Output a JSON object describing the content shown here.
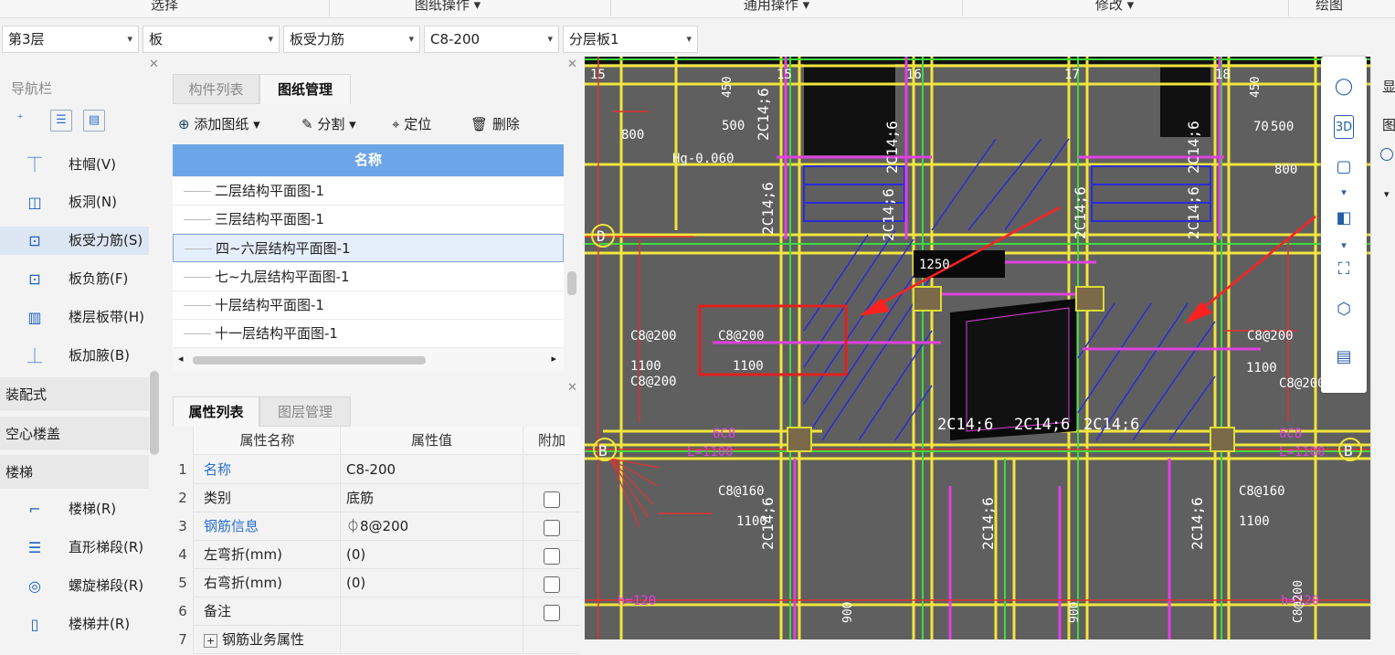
{
  "ribbon": {
    "groups": [
      "选择",
      "图纸操作 ▾",
      "通用操作 ▾",
      "修改 ▾",
      "绘图"
    ]
  },
  "toolbar": {
    "floor": "第3层",
    "type": "板",
    "subtype": "板受力筋",
    "spec": "C8-200",
    "layer": "分层板1"
  },
  "nav": {
    "title": "导航栏",
    "items": [
      {
        "label": "柱帽(V)",
        "icon": "column-cap-icon"
      },
      {
        "label": "板洞(N)",
        "icon": "slab-hole-icon"
      },
      {
        "label": "板受力筋(S)",
        "icon": "slab-rebar-icon"
      },
      {
        "label": "板负筋(F)",
        "icon": "slab-negative-rebar-icon"
      },
      {
        "label": "楼层板带(H)",
        "icon": "floor-strip-icon"
      },
      {
        "label": "板加腋(B)",
        "icon": "slab-haunch-icon"
      }
    ],
    "categories": [
      "装配式",
      "空心楼盖",
      "楼梯"
    ],
    "stair_items": [
      {
        "label": "楼梯(R)",
        "icon": "stair-icon"
      },
      {
        "label": "直形梯段(R)",
        "icon": "straight-flight-icon"
      },
      {
        "label": "螺旋梯段(R)",
        "icon": "spiral-flight-icon"
      },
      {
        "label": "楼梯井(R)",
        "icon": "stairwell-icon"
      }
    ]
  },
  "drawings": {
    "tabs": [
      "构件列表",
      "图纸管理"
    ],
    "buttons": [
      "添加图纸",
      "分割",
      "定位",
      "删除"
    ],
    "column_header": "名称",
    "rows": [
      "二层结构平面图-1",
      "三层结构平面图-1",
      "四~六层结构平面图-1",
      "七~九层结构平面图-1",
      "十层结构平面图-1",
      "十一层结构平面图-1"
    ],
    "selected_index": 2
  },
  "properties": {
    "tabs": [
      "属性列表",
      "图层管理"
    ],
    "headers": [
      "属性名称",
      "属性值",
      "附加"
    ],
    "rows": [
      {
        "n": "1",
        "key": "名称",
        "val": "C8-200",
        "blue": true,
        "checkbox": false
      },
      {
        "n": "2",
        "key": "类别",
        "val": "底筋",
        "blue": false,
        "checkbox": true
      },
      {
        "n": "3",
        "key": "钢筋信息",
        "val": "⏀8@200",
        "blue": true,
        "checkbox": true
      },
      {
        "n": "4",
        "key": "左弯折(mm)",
        "val": "(0)",
        "blue": false,
        "checkbox": true
      },
      {
        "n": "5",
        "key": "右弯折(mm)",
        "val": "(0)",
        "blue": false,
        "checkbox": true
      },
      {
        "n": "6",
        "key": "备注",
        "val": "",
        "blue": false,
        "checkbox": true
      },
      {
        "n": "7",
        "key": "钢筋业务属性",
        "val": "",
        "blue": false,
        "checkbox": false
      }
    ]
  },
  "cad": {
    "grid_labels": [
      "15",
      "16",
      "17",
      "18",
      "D",
      "B"
    ],
    "texts": [
      "450",
      "500",
      "800",
      "Hg-0.060",
      "2C14;6",
      "1100",
      "C8@200",
      "1250",
      "C8@160",
      "6C8",
      "L=1100",
      "900",
      "70",
      "h=120"
    ]
  },
  "right_panel": {
    "labels": [
      "显",
      "图"
    ]
  }
}
